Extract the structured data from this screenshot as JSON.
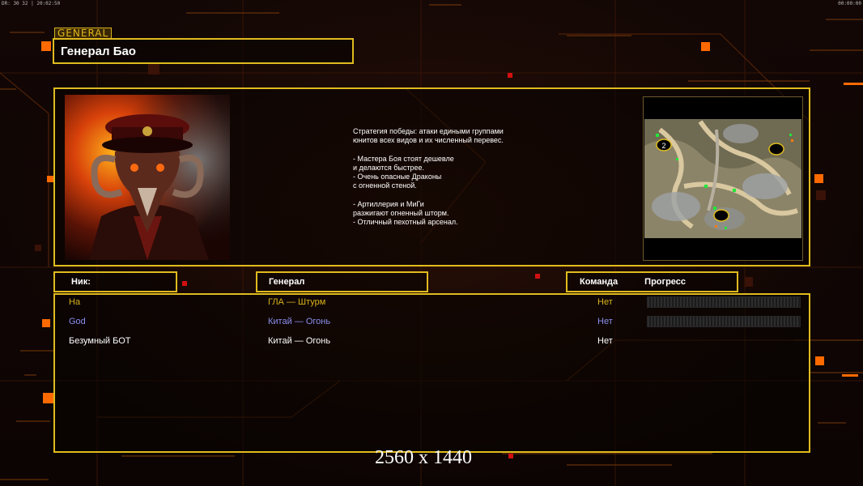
{
  "hud": {
    "left_text": "DR: 30 32 | 20:02:50",
    "right_text": "00:00:00"
  },
  "general_tag": "GENERAL",
  "title": "Генерал Бао",
  "description": "Стратегия победы: атаки едиными группами\nюнитов всех видов и их численный перевес.\n\n- Мастера Боя стоят дешевле\nи делаются быстрее.\n- Очень опасные Драконы\nс огненной стеной.\n\n- Артиллерия и МиГи\nразжигают огненный шторм.\n- Отличный пехотный арсенал.",
  "headers": {
    "nick": "Ник:",
    "general": "Генерал",
    "team": "Команда",
    "progress": "Прогресс"
  },
  "players": [
    {
      "nick": "На",
      "general": "ГЛА — Штурм",
      "team": "Нет",
      "has_progress": true,
      "nick_color": "#d9b21c",
      "general_color": "#d9b21c",
      "team_color": "#d9b21c"
    },
    {
      "nick": "God",
      "general": "Китай — Огонь",
      "team": "Нет",
      "has_progress": true,
      "nick_color": "#8b8ff0",
      "general_color": "#8b8ff0",
      "team_color": "#8b8ff0"
    },
    {
      "nick": "Безумный БОТ",
      "general": "Китай — Огонь",
      "team": "Нет",
      "has_progress": false,
      "nick_color": "#ffffff",
      "general_color": "#ffffff",
      "team_color": "#ffffff"
    }
  ],
  "map": {
    "start_marker_label": "2"
  },
  "resolution_label": "2560 x 1440",
  "colors": {
    "accent": "#e0bb1e",
    "orange": "#ff6a00"
  }
}
